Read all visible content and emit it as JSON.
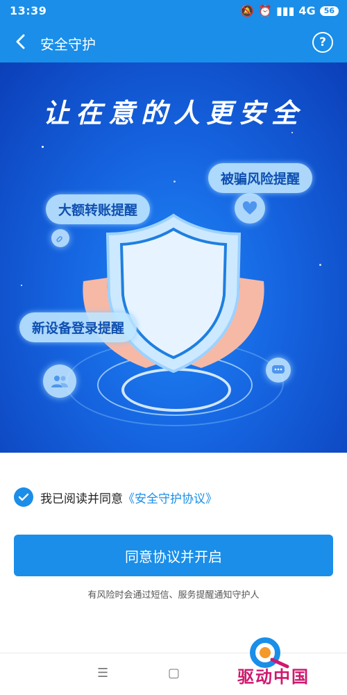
{
  "status_bar": {
    "time": "13:39",
    "network": "4G",
    "battery": "56"
  },
  "header": {
    "title": "安全守护",
    "help": "?"
  },
  "hero": {
    "slogan": "让在意的人更安全",
    "bubbles": [
      "被骗风险提醒",
      "大额转账提醒",
      "新设备登录提醒"
    ]
  },
  "agreement": {
    "prefix": "我已阅读并同意",
    "link": "《安全守护协议》",
    "checked": true
  },
  "primary_button": "同意协议并开启",
  "note": "有风险时会通过短信、服务提醒通知守护人",
  "watermark": {
    "text": "驱动中国"
  },
  "colors": {
    "accent": "#1a8ee8",
    "hero_dark": "#0b3fb8",
    "watermark": "#d0186e"
  }
}
